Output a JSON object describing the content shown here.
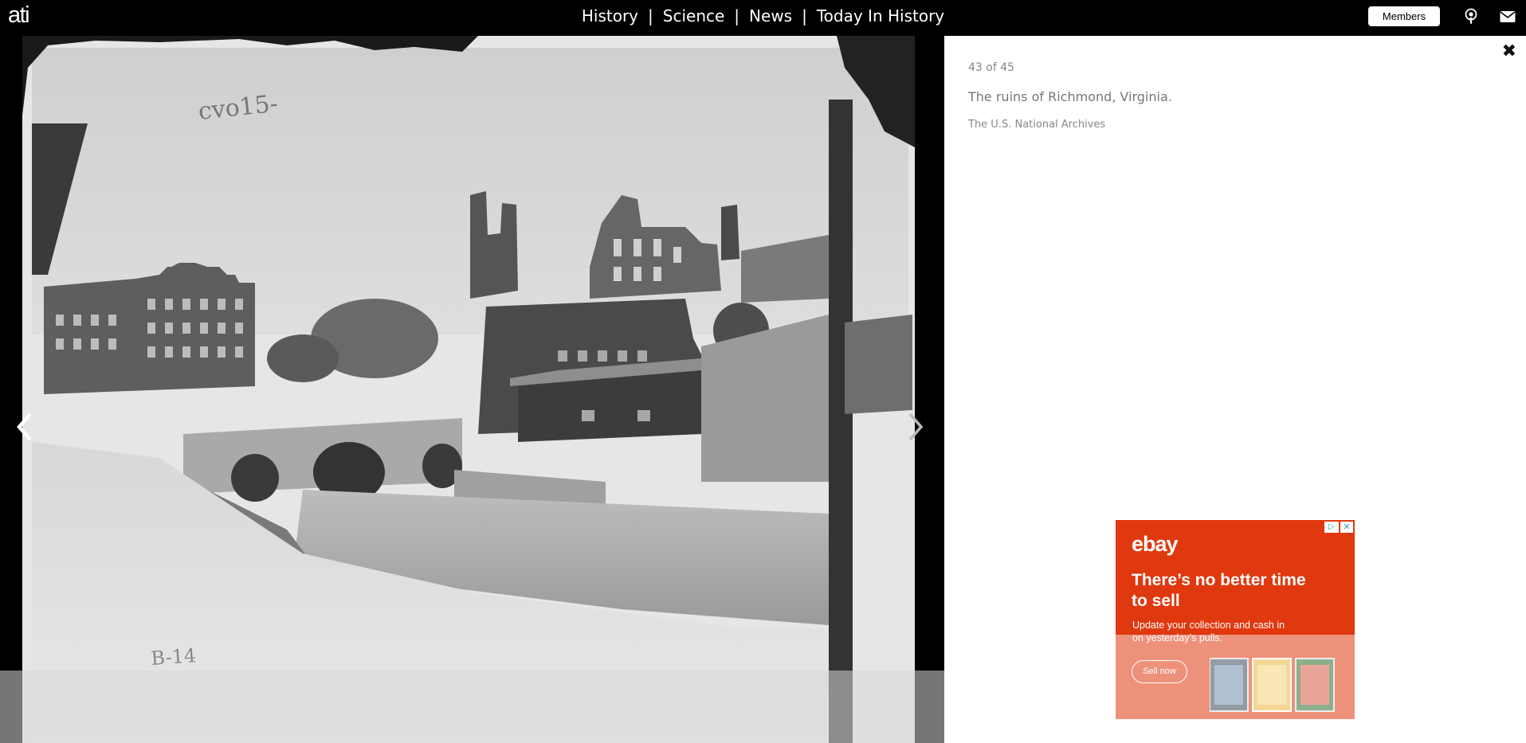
{
  "header": {
    "logo": "ati",
    "nav": [
      {
        "label": "History"
      },
      {
        "label": "Science"
      },
      {
        "label": "News"
      },
      {
        "label": "Today In History"
      }
    ],
    "separator": "|",
    "members_label": "Members",
    "icons": [
      "podcast-icon",
      "mail-icon"
    ]
  },
  "gallery": {
    "prev_icon": "chevron-left-icon",
    "next_icon": "chevron-right-icon"
  },
  "panel": {
    "close": "✖",
    "counter": "43 of 45",
    "title": "The ruins of Richmond, Virginia.",
    "credit": "The U.S. National Archives"
  },
  "ad": {
    "brand": "ebay",
    "headline": "There’s no better time to sell",
    "body": "Update your collection and cash in on yesterday’s pulls.",
    "button": "Sell now",
    "choices_glyph": "▷",
    "close_glyph": "✕",
    "brand_color": "#e0380f"
  },
  "colors": {
    "topbar": "#000000",
    "panel": "#ffffff",
    "muted_text": "#888888"
  }
}
